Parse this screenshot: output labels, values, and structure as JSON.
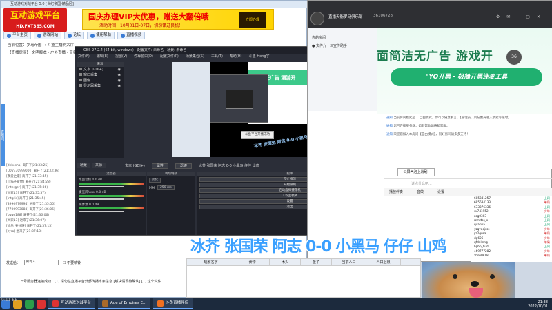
{
  "platform": {
    "window_title": "互动游戏对战平台 5.0 [世纪帝国-精品区]",
    "logo": {
      "main": "互动游戏平台",
      "sub": "HD.FXT365.COM"
    },
    "banner": {
      "title": "国庆办理VIP大优惠，赠送大翻倍哦",
      "subtitle": "活动时间：10月01日-07日，切勿错过良机！",
      "badge": "立即办理"
    },
    "nav": [
      "平台主页",
      "游戏网站",
      "论坛",
      "使用帮助",
      "直播视频"
    ],
    "breadcrumb": "当前位置：罗马帝国 → 斗鱼主播刷大厅",
    "tabs_line": "【直播房间】 文明版本 · 户外直播 · 音频",
    "side_tab": "直播间",
    "chat_lines": [
      "[dekesha] 离开了(21:33:25)",
      "[LOVE70999000] 离开了(21:33:36)",
      "[我爱之家] 离开了(21:33:45)",
      "[小猫子爱你] 离开了(21:34:28)",
      "[Interger] 离开了(21:35:36)",
      "[大家13] 离开了(21:35:37)",
      "[Intgris] 离开了(21:35:45)",
      "[3990979994] 进来了(21:35:56)",
      "[7700993088] 离开了(21:36:06)",
      "[pggo188] 离开了(21:36:06)",
      "[大家13] 进来了(21:36:07)",
      "[仙乐_要好呀] 离开了(21:37:15)",
      "[zyro] 进来了(21:37:18)"
    ],
    "bottom_label": "发送给：",
    "bottom_select": "所有人",
    "bottom_check": "不要响铃",
    "status": "5号服务器连接成功！[1] 请勿在直播平台外部传播本条信息 [解决情况待确认] [1] 这个文件"
  },
  "obs": {
    "title": "OBS 27.2.4 (64-bit, windows) - 配置文件: 未命名 - 场景: 未命名",
    "menu": [
      "文件(F)",
      "编辑(E)",
      "视图(V)",
      "停靠窗口(D)",
      "配置文件(P)",
      "场景集合(S)",
      "工具(T)",
      "帮助(H)",
      "斗鱼-Hong字"
    ],
    "scenes_header": "来源",
    "sources": [
      "文本 (GDI+)",
      "窗口采集",
      "图像",
      "显示器采集"
    ],
    "dock_tabs": [
      "场景",
      "来源"
    ],
    "source_bar": [
      "文本 (GDI+)",
      "属性",
      "滤镜",
      "冰芥 张国荣 阿志 0-0 小黑马 仔仔 山鸡"
    ],
    "preview_caption": "冰芥 张国荣 阿志 0-0 小黑马 仔仔 山鸡",
    "preview_toast": "斗鱼平台开播成功",
    "preview_ad": "面简洁无广告 酒游开",
    "mixer_header": "混音器",
    "mixer_tracks": [
      {
        "name": "桌面音频",
        "db": "0.0 dB"
      },
      {
        "name": "麦克风/Aux",
        "db": "0.0 dB"
      },
      {
        "name": "媒体源",
        "db": "0.0 dB"
      }
    ],
    "trans_header": "转场特效",
    "trans_type": "淡化",
    "trans_duration_label": "时长",
    "trans_duration": "250 ms",
    "controls_header": "控件",
    "controls": [
      "停止推流",
      "开始录制",
      "启动虚拟摄像机",
      "工作室模式",
      "设置",
      "退出"
    ]
  },
  "chat": {
    "room_name": "直播天衡罗马俱乐部",
    "room_id": "36106728",
    "left_items": [
      "你的房间",
      "● 文件九十三宣传助手"
    ],
    "ad_title": "面简洁无广告 游戏开",
    "ad_sub": "\"YO开黑 - 极简开黑连麦工具",
    "ad_timer": "36",
    "messages": [
      {
        "tag": "通知",
        "text": "当前房间模式是 ：自由模式，你可以随意发言，【管理员、风纪委员进入模式等级时】"
      },
      {
        "tag": "通知",
        "text": "您已连接服务器，如有帮助请通知客服。"
      },
      {
        "tag": "通知",
        "text": "欢迎您加入本房间【自由模式】，同好房间请多多支持！"
      }
    ],
    "bubble": "公屏气泡上战刷!",
    "input_placeholder": "说点什么吧...",
    "toolbar": [
      "播放伴奏",
      "音效",
      "设置"
    ],
    "users": [
      {
        "name": "605341257",
        "status": "上网"
      },
      {
        "name": "695684133",
        "status": "单局"
      },
      {
        "name": "673376336",
        "status": "上网"
      },
      {
        "name": "sx741952",
        "status": "少年"
      },
      {
        "name": "xcg0303",
        "status": "上网"
      },
      {
        "name": "rcmttss_x",
        "status": "上网"
      },
      {
        "name": "quapha",
        "status": "上网"
      },
      {
        "name": "yzqvqcjsss",
        "status": "少年"
      },
      {
        "name": "yz2gusa",
        "status": "单局"
      },
      {
        "name": "dg606",
        "status": "少年"
      },
      {
        "name": "qfdnlinng",
        "status": "单局"
      },
      {
        "name": "hp66_hudi",
        "status": "上网"
      },
      {
        "name": "469777282",
        "status": "少年"
      },
      {
        "name": "zhou0818",
        "status": "单局"
      }
    ]
  },
  "overlay_text": "冰芥 张国荣 阿志 0-0 小黑马 仔仔 山鸡",
  "table": {
    "headers": [
      "玩家名字",
      "食物",
      "木头",
      "金子",
      "当前人口",
      "人口上限"
    ]
  },
  "taskbar": {
    "apps": [
      {
        "label": "互动游戏对战平台"
      },
      {
        "label": "Age of Empires E..."
      },
      {
        "label": "斗鱼直播伴侣"
      }
    ],
    "time": "21:38",
    "date": "2022/10/01"
  },
  "corner_watermark": "9:11 BB"
}
